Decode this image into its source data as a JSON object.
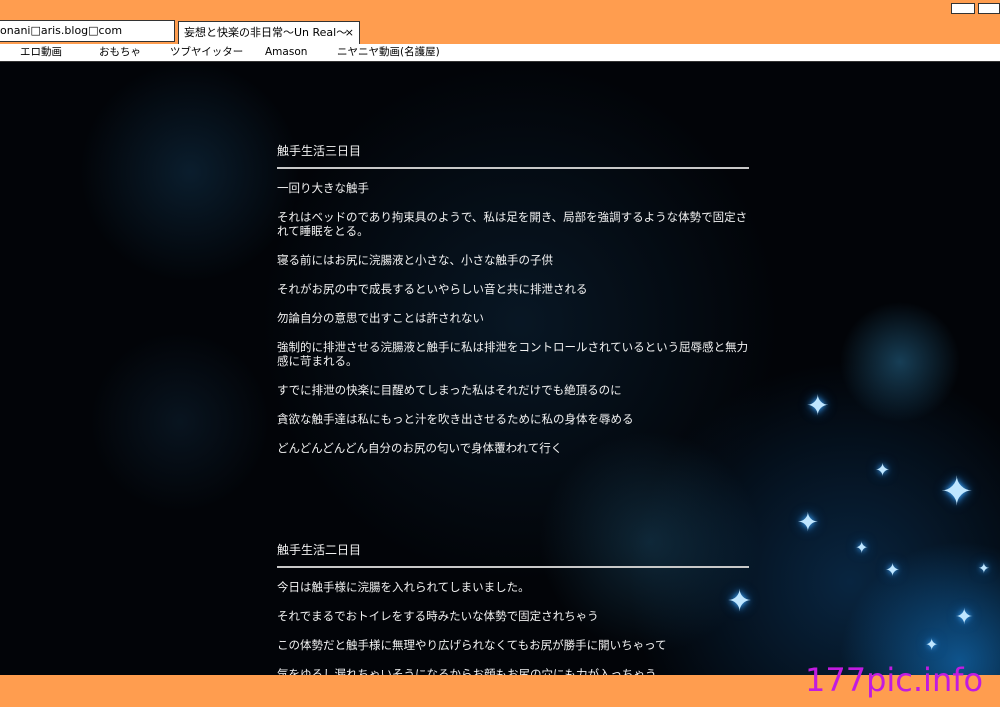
{
  "browser": {
    "address": "onani□aris.blog□com",
    "tab_title": "妄想と快楽の非日常〜Un Real〜",
    "tab_close": "×",
    "bookmarks": [
      "エロ動画",
      "おもちゃ",
      "ツブヤイッター",
      "Amason",
      "ニヤニヤ動画(名護屋)"
    ]
  },
  "posts": [
    {
      "title": "触手生活三日目",
      "paragraphs": [
        " 一回り大きな触手",
        "それはベッドのであり拘束具のようで、私は足を開き、局部を強調するような体勢で固定されて睡眠をとる。",
        "寝る前にはお尻に浣腸液と小さな、小さな触手の子供",
        "それがお尻の中で成長するといやらしい音と共に排泄される",
        "勿論自分の意思で出すことは許されない",
        "強制的に排泄させる浣腸液と触手に私は排泄をコントロールされているという屈辱感と無力感に苛まれる。",
        "すでに排泄の快楽に目醒めてしまった私はそれだけでも絶頂るのに",
        "貪欲な触手達は私にもっと汁を吹き出させるために私の身体を辱める",
        "どんどんどんどん自分のお尻の匂いで身体覆われて行く"
      ]
    },
    {
      "title": "触手生活二日目",
      "paragraphs": [
        " 今日は触手様に浣腸を入れられてしまいました。",
        "それでまるでおトイレをする時みたいな体勢で固定されちゃう",
        "この体勢だと触手様に無理やり広げられなくてもお尻が勝手に開いちゃって",
        "気をゆるし漏れちゃいそうになるからお顔もお尻の穴にも力が入っちゃう"
      ]
    }
  ],
  "watermark": "177pic.info",
  "colors": {
    "chrome": "#ff9d4f",
    "watermark": "#c21be0",
    "text": "#f2f2f2"
  }
}
